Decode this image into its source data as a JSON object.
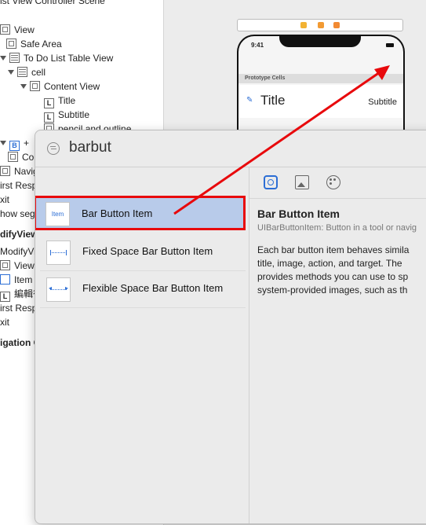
{
  "outline": {
    "rows": [
      {
        "text": "ist View Controller Scene"
      },
      {
        "text": "View"
      },
      {
        "text": "Safe Area"
      },
      {
        "text": "To Do List Table View"
      },
      {
        "text": "cell"
      },
      {
        "text": "Content View"
      },
      {
        "text": "Title",
        "icon": "L"
      },
      {
        "text": "Subtitle",
        "icon": "L"
      },
      {
        "text": "pencil.and.outline"
      },
      {
        "text": "+",
        "icon": "B"
      },
      {
        "text": "Con"
      },
      {
        "text": "Navig"
      },
      {
        "text": "irst Resp"
      },
      {
        "text": "xit"
      },
      {
        "text": "how seg"
      },
      {
        "text": "difyView"
      },
      {
        "text": "ModifyVie"
      },
      {
        "text": "View"
      },
      {
        "text": "Item"
      },
      {
        "text": "編輯後"
      },
      {
        "text": "irst Resp"
      },
      {
        "text": "xit"
      },
      {
        "text": "igation C"
      }
    ]
  },
  "phone": {
    "time": "9:41",
    "section_header": "Prototype Cells",
    "cell_title": "Title",
    "cell_subtitle": "Subtitle",
    "scene_dot_colors": [
      "#f2b233",
      "#f29a33",
      "#f28a33"
    ]
  },
  "library": {
    "search_query": "barbut",
    "items": [
      {
        "label": "Bar Button Item",
        "thumb_text": "Item",
        "selected": true
      },
      {
        "label": "Fixed Space Bar Button Item"
      },
      {
        "label": "Flexible Space Bar Button Item"
      }
    ],
    "detail": {
      "title": "Bar Button Item",
      "subtitle": "UIBarButtonItem: Button in a tool or navig",
      "body_lines": [
        "Each bar button item behaves simila",
        "title, image, action, and target. The",
        "provides methods you can use to sp",
        "system-provided images, such as th"
      ]
    }
  },
  "colors": {
    "accent": "#2c6ed5",
    "selection": "#b8cbea",
    "annotation": "#e8090c"
  }
}
